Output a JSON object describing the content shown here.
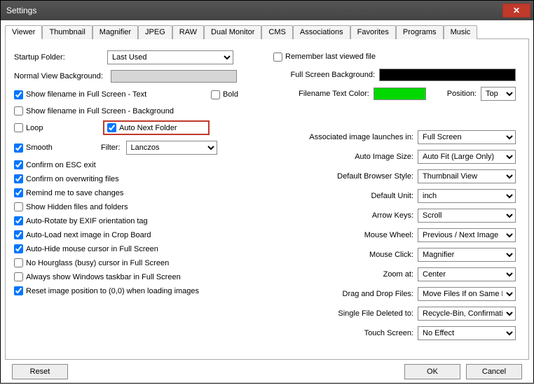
{
  "window": {
    "title": "Settings"
  },
  "tabs": [
    "Viewer",
    "Thumbnail",
    "Magnifier",
    "JPEG",
    "RAW",
    "Dual Monitor",
    "CMS",
    "Associations",
    "Favorites",
    "Programs",
    "Music"
  ],
  "left": {
    "startup_folder_label": "Startup Folder:",
    "startup_folder_value": "Last Used",
    "remember_label": "Remember last viewed file",
    "normal_bg_label": "Normal View Background:",
    "normal_bg_color": "#d6d6d6",
    "show_fn_text_label": "Show filename in Full Screen - Text",
    "bold_label": "Bold",
    "show_fn_bg_label": "Show filename in Full Screen - Background",
    "loop_label": "Loop",
    "auto_next_folder_label": "Auto Next Folder",
    "smooth_label": "Smooth",
    "filter_label": "Filter:",
    "filter_value": "Lanczos",
    "chk_confirm_esc": "Confirm on ESC exit",
    "chk_confirm_overwrite": "Confirm on overwriting files",
    "chk_remind_save": "Remind me to save changes",
    "chk_show_hidden": "Show Hidden files and folders",
    "chk_auto_rotate": "Auto-Rotate by EXIF orientation tag",
    "chk_auto_load_crop": "Auto-Load next image in Crop Board",
    "chk_auto_hide_cursor": "Auto-Hide mouse cursor in Full Screen",
    "chk_no_hourglass": "No Hourglass (busy) cursor in Full Screen",
    "chk_always_taskbar": "Always show Windows taskbar in Full Screen",
    "chk_reset_pos": "Reset image position to (0,0) when loading images"
  },
  "right": {
    "fs_bg_label": "Full Screen Background:",
    "fs_bg_color": "#000000",
    "fn_text_color_label": "Filename Text Color:",
    "fn_text_color": "#00d800",
    "position_label": "Position:",
    "position_value": "Top",
    "assoc_launch_label": "Associated image launches in:",
    "assoc_launch_value": "Full Screen",
    "auto_image_size_label": "Auto Image Size:",
    "auto_image_size_value": "Auto Fit (Large Only)",
    "default_browser_label": "Default Browser Style:",
    "default_browser_value": "Thumbnail View",
    "default_unit_label": "Default Unit:",
    "default_unit_value": "inch",
    "arrow_keys_label": "Arrow Keys:",
    "arrow_keys_value": "Scroll",
    "mouse_wheel_label": "Mouse Wheel:",
    "mouse_wheel_value": "Previous / Next Image",
    "mouse_click_label": "Mouse Click:",
    "mouse_click_value": "Magnifier",
    "zoom_at_label": "Zoom at:",
    "zoom_at_value": "Center",
    "drag_drop_label": "Drag and Drop Files:",
    "drag_drop_value": "Move Files If on Same Disk",
    "single_delete_label": "Single File Deleted to:",
    "single_delete_value": "Recycle-Bin, Confirmation",
    "touch_label": "Touch Screen:",
    "touch_value": "No Effect"
  },
  "buttons": {
    "reset": "Reset",
    "ok": "OK",
    "cancel": "Cancel"
  }
}
